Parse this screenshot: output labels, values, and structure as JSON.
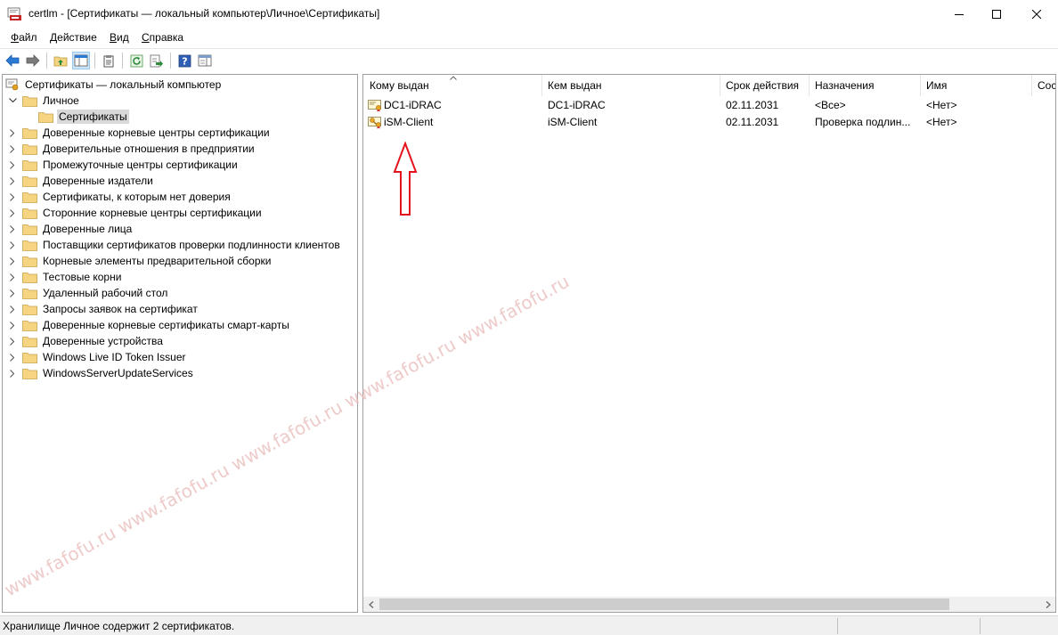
{
  "window": {
    "title": "certlm - [Сертификаты — локальный компьютер\\Личное\\Сертификаты]"
  },
  "menu": {
    "file_u": "Ф",
    "file_rest": "айл",
    "action_u": "Д",
    "action_rest": "ействие",
    "view_u": "В",
    "view_rest": "ид",
    "help_u": "С",
    "help_rest": "правка"
  },
  "tree": {
    "root": "Сертификаты — локальный компьютер",
    "personal": "Личное",
    "certificates": "Сертификаты",
    "items": [
      "Доверенные корневые центры сертификации",
      "Доверительные отношения в предприятии",
      "Промежуточные центры сертификации",
      "Доверенные издатели",
      "Сертификаты, к которым нет доверия",
      "Сторонние корневые центры сертификации",
      "Доверенные лица",
      "Поставщики сертификатов проверки подлинности клиентов",
      "Корневые элементы предварительной сборки",
      "Тестовые корни",
      "Удаленный рабочий стол",
      "Запросы заявок на сертификат",
      "Доверенные корневые сертификаты смарт-карты",
      "Доверенные устройства",
      "Windows Live ID Token Issuer",
      "WindowsServerUpdateServices"
    ]
  },
  "list": {
    "columns": [
      "Кому выдан",
      "Кем выдан",
      "Срок действия",
      "Назначения",
      "Имя",
      "Сос"
    ],
    "rows": [
      [
        "DC1-iDRAC",
        "DC1-iDRAC",
        "02.11.2031",
        "<Все>",
        "<Нет>"
      ],
      [
        "iSM-Client",
        "iSM-Client",
        "02.11.2031",
        "Проверка подлин...",
        "<Нет>"
      ]
    ]
  },
  "status": {
    "text": "Хранилище Личное содержит 2 сертификатов."
  },
  "watermark": {
    "text": "www.fafofu.ru www.fafofu.ru www.fafofu.ru www.fafofu.ru www.fafofu.ru"
  },
  "colors": {
    "annotation_arrow": "#e3141b",
    "folder": "#f5d482",
    "watermark": "#e8b8b8"
  }
}
